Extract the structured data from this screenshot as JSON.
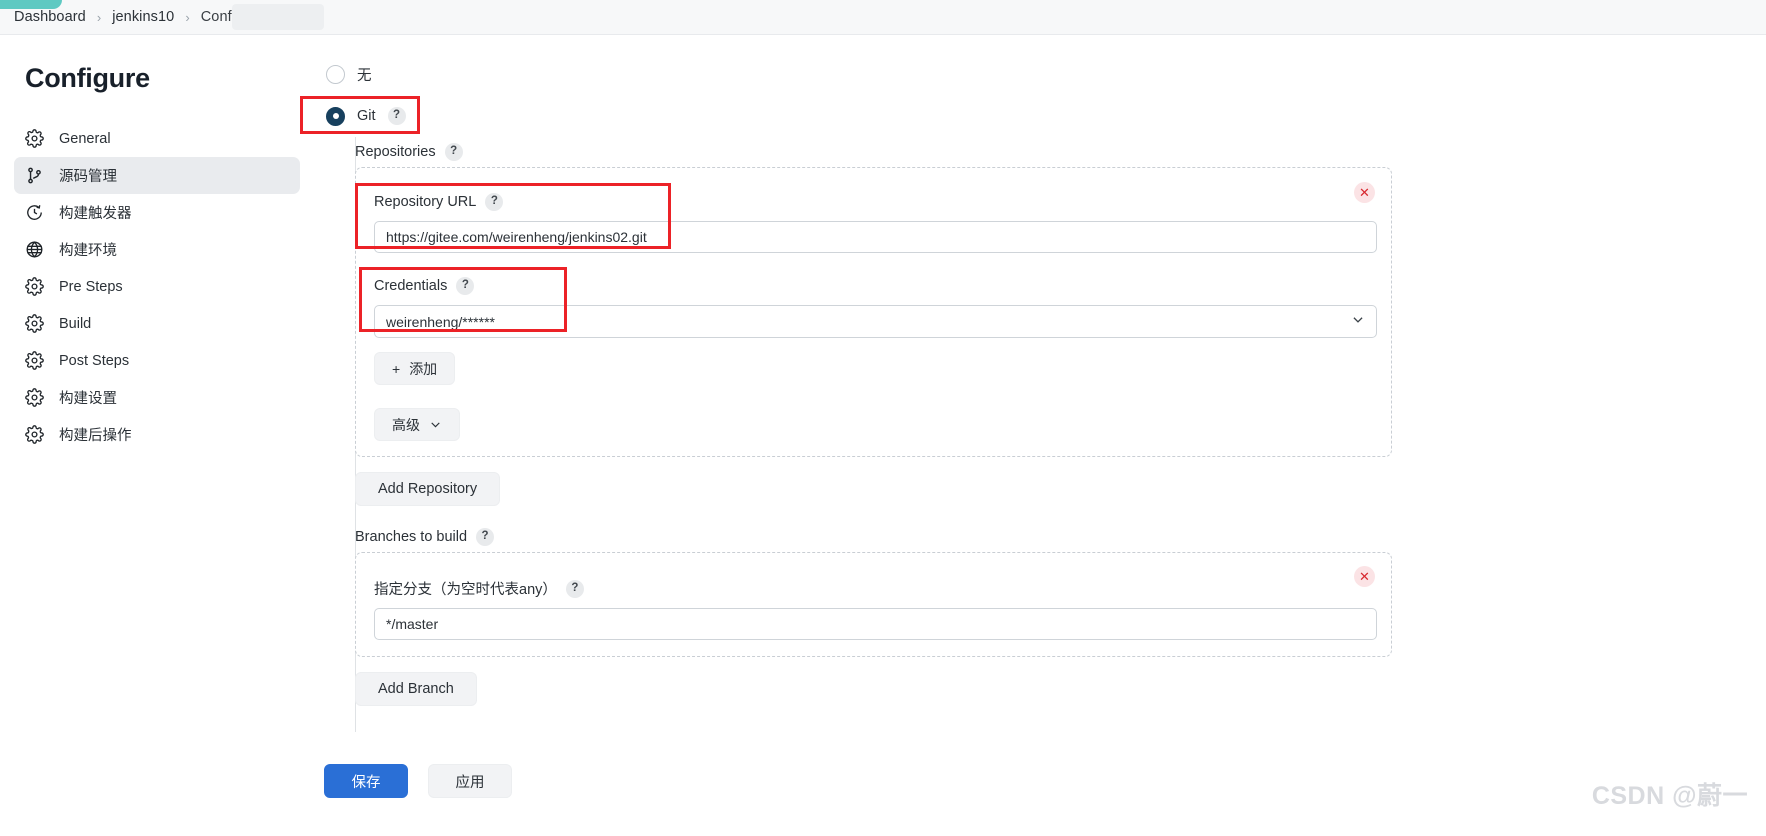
{
  "breadcrumb": {
    "items": [
      {
        "label": "Dashboard"
      },
      {
        "label": "jenkins10"
      },
      {
        "label": "Configuration"
      }
    ],
    "separator": "›"
  },
  "sidebar": {
    "title": "Configure",
    "items": [
      {
        "label": "General",
        "icon": "gear-icon",
        "active": false
      },
      {
        "label": "源码管理",
        "icon": "branch-icon",
        "active": true
      },
      {
        "label": "构建触发器",
        "icon": "clock-icon",
        "active": false
      },
      {
        "label": "构建环境",
        "icon": "globe-icon",
        "active": false
      },
      {
        "label": "Pre Steps",
        "icon": "gear-icon",
        "active": false
      },
      {
        "label": "Build",
        "icon": "gear-icon",
        "active": false
      },
      {
        "label": "Post Steps",
        "icon": "gear-icon",
        "active": false
      },
      {
        "label": "构建设置",
        "icon": "gear-icon",
        "active": false
      },
      {
        "label": "构建后操作",
        "icon": "gear-icon",
        "active": false
      }
    ]
  },
  "scm": {
    "options": [
      {
        "label": "无",
        "selected": false,
        "help": false
      },
      {
        "label": "Git",
        "selected": true,
        "help": true
      }
    ],
    "help_glyph": "?",
    "repositories_label": "Repositories",
    "repository": {
      "url_label": "Repository URL",
      "url_value": "https://gitee.com/weirenheng/jenkins02.git",
      "credentials_label": "Credentials",
      "credentials_value": "weirenheng/******",
      "add_credentials_label": "添加",
      "add_credentials_plus": "+",
      "advanced_label": "高级",
      "delete_glyph": "✕"
    },
    "add_repository_label": "Add Repository",
    "branches_label": "Branches to build",
    "branch": {
      "specifier_label": "指定分支（为空时代表any）",
      "specifier_value": "*/master",
      "delete_glyph": "✕"
    },
    "add_branch_label": "Add Branch"
  },
  "footer": {
    "save_label": "保存",
    "apply_label": "应用"
  },
  "watermark": "CSDN @蔚一",
  "colors": {
    "accent_teal": "#5ec9c2",
    "radio_selected": "#17405e",
    "annotation_red": "#ec2227",
    "primary_button": "#2a6fd6",
    "sidebar_active": "#e9ebee"
  }
}
